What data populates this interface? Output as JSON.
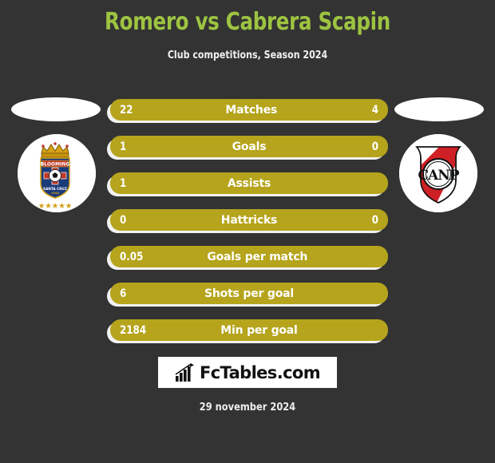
{
  "header": {
    "title": "Romero vs Cabrera Scapin",
    "subtitle": "Club competitions, Season 2024",
    "title_color": "#9dc441",
    "subtitle_color": "#f0f0f0"
  },
  "theme": {
    "background": "#333333",
    "bar_color": "#b5a41c",
    "bar_back_color": "#f2f2f2",
    "text_color": "#ffffff"
  },
  "teams": {
    "home": {
      "badge_name": "club-blooming-badge",
      "badge_text": "BLOOMING",
      "badge_subtext": "SANTA CRUZ",
      "badge_year": "1946"
    },
    "away": {
      "badge_name": "canp-badge",
      "badge_text": "CANP"
    }
  },
  "stats": [
    {
      "label": "Matches",
      "home": "22",
      "away": "4"
    },
    {
      "label": "Goals",
      "home": "1",
      "away": "0"
    },
    {
      "label": "Assists",
      "home": "1",
      "away": ""
    },
    {
      "label": "Hattricks",
      "home": "0",
      "away": "0"
    },
    {
      "label": "Goals per match",
      "home": "0.05",
      "away": ""
    },
    {
      "label": "Shots per goal",
      "home": "6",
      "away": ""
    },
    {
      "label": "Min per goal",
      "home": "2184",
      "away": ""
    }
  ],
  "footer": {
    "logo_text": "FcTables.com",
    "logo_icon": "bar-chart-growth-icon",
    "date": "29 november 2024"
  }
}
